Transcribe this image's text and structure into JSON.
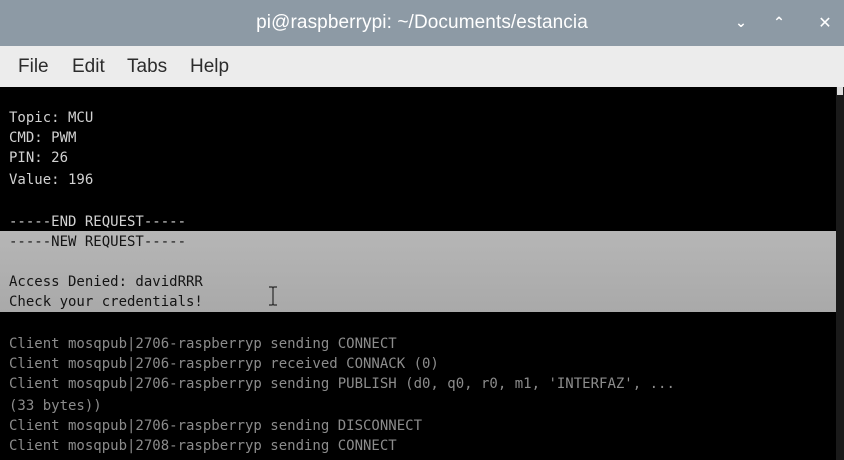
{
  "window": {
    "title": "pi@raspberrypi: ~/Documents/estancia",
    "controls": {
      "minimize": "⌄",
      "maximize": "⌃",
      "close": "✕"
    }
  },
  "menubar": {
    "items": [
      "File",
      "Edit",
      "Tabs",
      "Help"
    ]
  },
  "terminal": {
    "lines": [
      "Topic: MCU",
      "CMD: PWM",
      "PIN: 26",
      "Value: 196",
      "",
      "-----END REQUEST-----",
      "-----NEW REQUEST-----",
      "",
      "Access Denied: davidRRR",
      "Check your credentials!",
      "",
      "Client mosqpub|2706-raspberryp sending CONNECT",
      "Client mosqpub|2706-raspberryp received CONNACK (0)",
      "Client mosqpub|2706-raspberryp sending PUBLISH (d0, q0, r0, m1, 'INTERFAZ', ...",
      "(33 bytes))",
      "Client mosqpub|2706-raspberryp sending DISCONNECT",
      "Client mosqpub|2708-raspberryp sending CONNECT"
    ]
  },
  "colors": {
    "titlebar": "#8d9aa5",
    "menubar": "#ececec",
    "terminal_bg": "#000000",
    "selection": "#b0b0b0"
  }
}
